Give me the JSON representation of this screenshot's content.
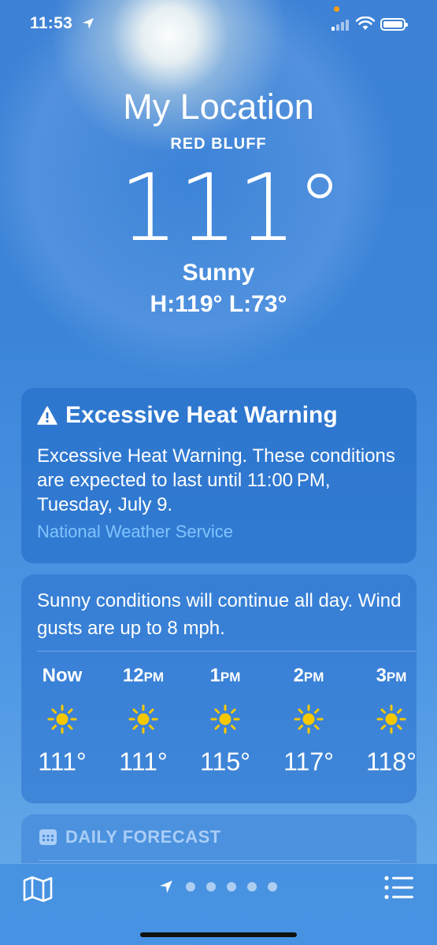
{
  "status_bar": {
    "time": "11:53"
  },
  "hero": {
    "location": "My Location",
    "city": "RED BLUFF",
    "temperature": "111°",
    "condition": "Sunny",
    "hi_lo": "H:119°  L:73°"
  },
  "alert": {
    "title": "Excessive Heat Warning",
    "body": "Excessive Heat Warning. These conditions are expected to last until 11:00 PM, Tuesday, July 9.",
    "source": "National Weather Service"
  },
  "hourly": {
    "summary": "Sunny conditions will continue all day. Wind gusts are up to 8 mph.",
    "hours": [
      {
        "label": "Now",
        "suffix": "",
        "temp": "111°",
        "icon": "sun-icon"
      },
      {
        "label": "12",
        "suffix": "PM",
        "temp": "111°",
        "icon": "sun-icon"
      },
      {
        "label": "1",
        "suffix": "PM",
        "temp": "115°",
        "icon": "sun-icon"
      },
      {
        "label": "2",
        "suffix": "PM",
        "temp": "117°",
        "icon": "sun-icon"
      },
      {
        "label": "3",
        "suffix": "PM",
        "temp": "118°",
        "icon": "sun-icon"
      }
    ]
  },
  "daily": {
    "header": "DAILY FORECAST",
    "icon": "calendar-icon"
  },
  "toolbar": {
    "left_icon": "map-icon",
    "right_icon": "list-icon",
    "page_count": 5
  },
  "colors": {
    "sun": "#f7c800",
    "alert_source": "#7fc4ff",
    "status_dot": "#ff9f0a"
  }
}
